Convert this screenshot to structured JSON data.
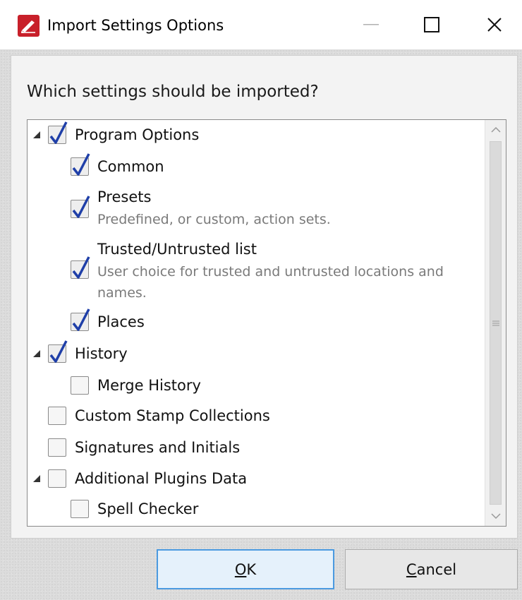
{
  "window": {
    "title": "Import Settings Options",
    "minimize_icon": "minimize-icon",
    "maximize_icon": "maximize-icon",
    "close_icon": "close-icon",
    "app_icon": "pdf-xchange-logo-icon"
  },
  "dialog": {
    "question": "Which settings should be imported?"
  },
  "tree": {
    "program_options": {
      "label": "Program Options",
      "checked": true,
      "expanded": true
    },
    "common": {
      "label": "Common",
      "checked": true
    },
    "presets": {
      "label": "Presets",
      "desc": "Predefined, or custom, action sets.",
      "checked": true
    },
    "trusted": {
      "label": "Trusted/Untrusted list",
      "desc": "User choice for trusted and untrusted locations and names.",
      "checked": true
    },
    "places": {
      "label": "Places",
      "checked": true
    },
    "history": {
      "label": "History",
      "checked": true,
      "expanded": true
    },
    "merge_history": {
      "label": "Merge History",
      "checked": false
    },
    "custom_stamps": {
      "label": "Custom Stamp Collections",
      "checked": false
    },
    "signatures": {
      "label": "Signatures and Initials",
      "checked": false
    },
    "plugins": {
      "label": "Additional Plugins Data",
      "checked": false,
      "expanded": true
    },
    "spell_checker": {
      "label": "Spell Checker",
      "checked": false
    }
  },
  "buttons": {
    "ok_mnemonic": "O",
    "ok_rest": "K",
    "cancel_mnemonic": "C",
    "cancel_rest": "ancel"
  },
  "colors": {
    "check": "#1f3fa8",
    "ok_border": "#4b9ae0"
  }
}
